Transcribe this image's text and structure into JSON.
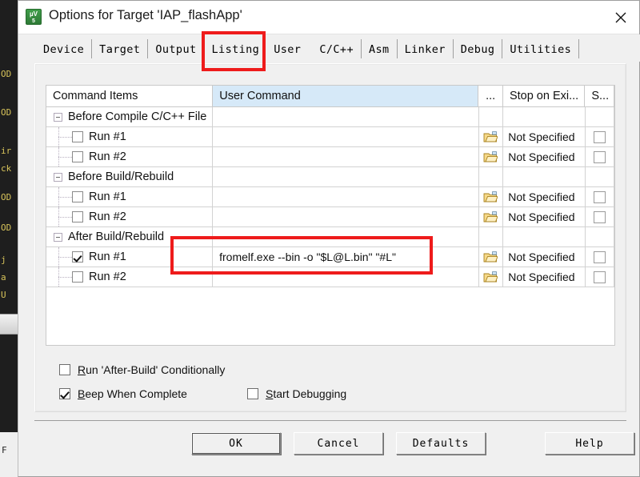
{
  "window": {
    "title": "Options for Target 'IAP_flashApp'",
    "app_icon_top": "µV",
    "app_icon_bottom": "5",
    "close_icon": "close-icon"
  },
  "tabs": [
    {
      "label": "Device",
      "selected": false
    },
    {
      "label": "Target",
      "selected": false
    },
    {
      "label": "Output",
      "selected": false
    },
    {
      "label": "Listing",
      "selected": false
    },
    {
      "label": "User",
      "selected": true
    },
    {
      "label": "C/C++",
      "selected": false
    },
    {
      "label": "Asm",
      "selected": false
    },
    {
      "label": "Linker",
      "selected": false
    },
    {
      "label": "Debug",
      "selected": false
    },
    {
      "label": "Utilities",
      "selected": false
    }
  ],
  "grid": {
    "columns": [
      {
        "key": "items",
        "label": "Command Items",
        "highlight": false
      },
      {
        "key": "cmd",
        "label": "User Command",
        "highlight": true
      },
      {
        "key": "dots",
        "label": "...",
        "highlight": false
      },
      {
        "key": "stop",
        "label": "Stop on Exi...",
        "highlight": false
      },
      {
        "key": "s",
        "label": "S...",
        "highlight": false
      }
    ],
    "rows": [
      {
        "kind": "group",
        "label": "Before Compile C/C++ File",
        "cmd": "",
        "browse": false,
        "stop": "",
        "stop_cb": false
      },
      {
        "kind": "child",
        "label": "Run #1",
        "checked": false,
        "cmd": "",
        "browse": true,
        "stop": "Not Specified",
        "stop_cb": true
      },
      {
        "kind": "child",
        "label": "Run #2",
        "checked": false,
        "cmd": "",
        "browse": true,
        "stop": "Not Specified",
        "stop_cb": true
      },
      {
        "kind": "group",
        "label": "Before Build/Rebuild",
        "cmd": "",
        "browse": false,
        "stop": "",
        "stop_cb": false
      },
      {
        "kind": "child",
        "label": "Run #1",
        "checked": false,
        "cmd": "",
        "browse": true,
        "stop": "Not Specified",
        "stop_cb": true
      },
      {
        "kind": "child",
        "label": "Run #2",
        "checked": false,
        "cmd": "",
        "browse": true,
        "stop": "Not Specified",
        "stop_cb": true
      },
      {
        "kind": "group",
        "label": "After Build/Rebuild",
        "cmd": "",
        "browse": false,
        "stop": "",
        "stop_cb": false
      },
      {
        "kind": "child",
        "label": "Run #1",
        "checked": true,
        "cmd": "fromelf.exe --bin -o \"$L@L.bin\" \"#L\"",
        "browse": true,
        "stop": "Not Specified",
        "stop_cb": true
      },
      {
        "kind": "child",
        "label": "Run #2",
        "checked": false,
        "cmd": "",
        "browse": true,
        "stop": "Not Specified",
        "stop_cb": true
      }
    ]
  },
  "options": [
    {
      "label_pre": "",
      "label_underline": "R",
      "label_post": "un 'After-Build' Conditionally",
      "checked": false
    },
    {
      "label_pre": "",
      "label_underline": "B",
      "label_post": "eep When Complete",
      "checked": true
    },
    {
      "label_pre": "",
      "label_underline": "S",
      "label_post": "tart Debugging",
      "checked": false
    }
  ],
  "buttons": [
    {
      "label": "OK",
      "default": true
    },
    {
      "label": "Cancel",
      "default": false
    },
    {
      "label": "Defaults",
      "default": false
    },
    {
      "label": "Help",
      "default": false
    }
  ],
  "annotations": {
    "colors": {
      "box": "#ee1b1b",
      "header_highlight": "#d6e9f8"
    },
    "targets": [
      "user-tab",
      "after-build-run1-command"
    ]
  },
  "backdrop": {
    "lines": [
      "OD",
      "OD",
      "ir",
      "ck",
      "OD",
      "OD",
      "j",
      "a",
      "U"
    ],
    "status": "F"
  }
}
